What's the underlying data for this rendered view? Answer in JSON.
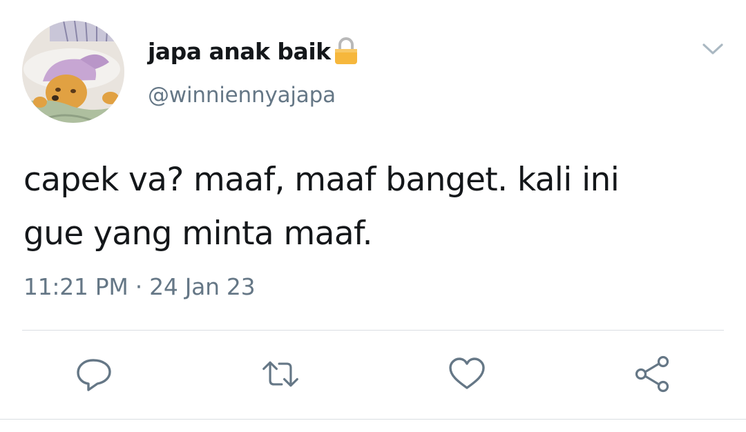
{
  "tweet": {
    "display_name": "japa anak baik",
    "handle": "@winniennyajapa",
    "text": "capek va? maaf, maaf banget. kali ini\ngue yang minta maaf.",
    "time": "11:21 PM",
    "separator": "·",
    "date": "24 Jan 23"
  },
  "icons": {
    "avatar": "winnie-the-pooh-sleeping-avatar",
    "lock": "lock-icon",
    "menu": "chevron-down-icon",
    "reply": "reply-icon",
    "retweet": "retweet-icon",
    "like": "heart-icon",
    "share": "share-icon"
  },
  "colors": {
    "text": "#14171a",
    "secondary": "#657786",
    "divider": "#d9dee2",
    "lock": "#f6b73c"
  }
}
